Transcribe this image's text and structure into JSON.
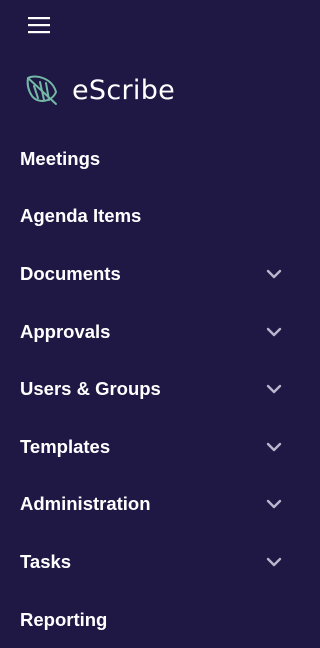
{
  "app": {
    "brand_name": "eScribe",
    "brand_color": "#74b8a6",
    "sidebar_bg": "#1f1845"
  },
  "toolbar": {
    "menu_icon": "hamburger-menu-icon"
  },
  "nav": {
    "items": [
      {
        "label": "Meetings",
        "expandable": false
      },
      {
        "label": "Agenda Items",
        "expandable": false
      },
      {
        "label": "Documents",
        "expandable": true
      },
      {
        "label": "Approvals",
        "expandable": true
      },
      {
        "label": "Users & Groups",
        "expandable": true
      },
      {
        "label": "Templates",
        "expandable": true
      },
      {
        "label": "Administration",
        "expandable": true
      },
      {
        "label": "Tasks",
        "expandable": true
      },
      {
        "label": "Reporting",
        "expandable": false
      }
    ],
    "expand_icon": "chevron-down-icon"
  }
}
